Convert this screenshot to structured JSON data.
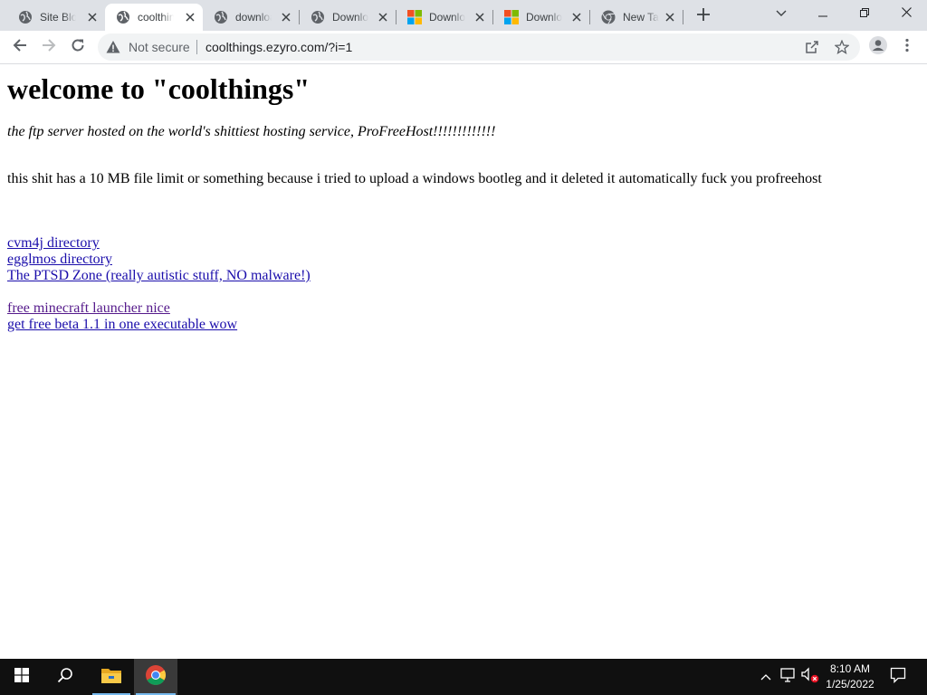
{
  "browser": {
    "tabs": [
      {
        "label": "Site Blocked",
        "favicon": "globe-icon",
        "active": false
      },
      {
        "label": "coolthings",
        "favicon": "globe-icon",
        "active": true
      },
      {
        "label": "download",
        "favicon": "globe-icon",
        "active": false
      },
      {
        "label": "Download",
        "favicon": "globe-icon",
        "active": false
      },
      {
        "label": "Download",
        "favicon": "microsoft-logo-icon",
        "active": false
      },
      {
        "label": "Download",
        "favicon": "microsoft-logo-icon",
        "active": false
      },
      {
        "label": "New Tab",
        "favicon": "chrome-icon",
        "active": false
      }
    ],
    "security_label": "Not secure",
    "url": "coolthings.ezyro.com/?i=1",
    "accent_color": "#1a73e8",
    "tab_strip_color": "#dee1e6"
  },
  "page": {
    "title": "welcome to \"coolthings\"",
    "subtitle": "the ftp server hosted on the world's shittiest hosting service, ProFreeHost!!!!!!!!!!!!!",
    "paragraph": "this shit has a 10 MB file limit or something because i tried to upload a windows bootleg and it deleted it automatically fuck you profreehost",
    "links": [
      {
        "text": "cvm4j directory",
        "visited": false
      },
      {
        "text": "egglmos directory",
        "visited": false
      },
      {
        "text": "The PTSD Zone (really autistic stuff, NO malware!)",
        "visited": false
      },
      {
        "text": "free minecraft launcher nice",
        "visited": true
      },
      {
        "text": "get free beta 1.1 in one executable wow",
        "visited": false
      }
    ],
    "link_color": "#1a0dab",
    "visited_link_color": "#551a8b"
  },
  "taskbar": {
    "items": [
      {
        "name": "start-button",
        "icon": "windows-logo-icon"
      },
      {
        "name": "search-button",
        "icon": "search-icon"
      },
      {
        "name": "file-explorer-button",
        "icon": "folder-icon"
      },
      {
        "name": "chrome-taskbar-button",
        "icon": "chrome-icon"
      }
    ],
    "tray_icons": [
      "chevron-up-icon",
      "network-icon",
      "volume-muted-icon",
      "notification-icon"
    ],
    "time": "8:10 AM",
    "date": "1/25/2022"
  }
}
